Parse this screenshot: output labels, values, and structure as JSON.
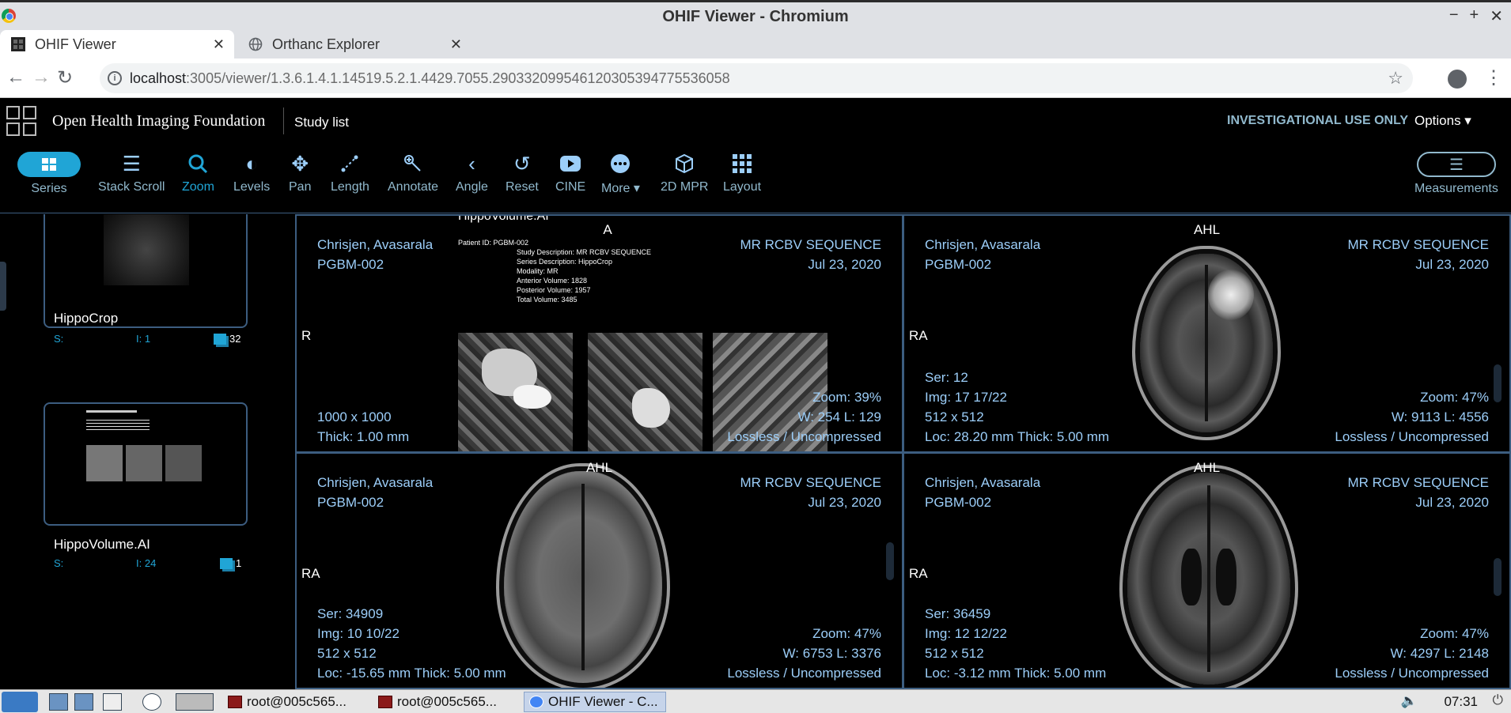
{
  "browser": {
    "window_title": "OHIF Viewer - Chromium",
    "window_buttons": [
      "−",
      "+",
      "✕"
    ],
    "tabs": [
      {
        "label": "OHIF Viewer",
        "close": "✕"
      },
      {
        "label": "Orthanc Explorer",
        "close": "✕"
      }
    ],
    "new_tab": "+",
    "url_host": "localhost",
    "url_path": ":3005/viewer/1.3.6.1.4.1.14519.5.2.1.4429.7055.290332099546120305394775536058",
    "info_glyph": "i",
    "star_glyph": "☆",
    "menu_glyph": "⋮"
  },
  "header": {
    "org_name": "Open Health Imaging Foundation",
    "study_list": "Study list",
    "investigational": "INVESTIGATIONAL USE ONLY",
    "options": "Options ▾"
  },
  "toolbar": {
    "series": "Series",
    "stack_scroll": "Stack Scroll",
    "zoom": "Zoom",
    "levels": "Levels",
    "pan": "Pan",
    "length": "Length",
    "annotate": "Annotate",
    "angle": "Angle",
    "reset": "Reset",
    "cine": "CINE",
    "more": "More ▾",
    "mpr": "2D MPR",
    "layout": "Layout",
    "measurements": "Measurements"
  },
  "series_panel": {
    "items": [
      {
        "title": "HippoCrop",
        "s_label": "S:",
        "i_label": "I: 1",
        "count": "32"
      },
      {
        "title": "HippoVolume.AI",
        "s_label": "S:",
        "i_label": "I: 24",
        "count": "1"
      }
    ]
  },
  "viewports": {
    "vp1": {
      "ori_top": "A",
      "ori_left": "R",
      "patient": "Chrisjen, Avasarala",
      "patient_id": "PGBM-002",
      "series_desc": "MR RCBV SEQUENCE",
      "date": "Jul 23, 2020",
      "dims": "1000 x 1000",
      "thick": "Thick: 1.00 mm",
      "zoom": "Zoom: 39%",
      "wl": "W: 254 L: 129",
      "compression": "Lossless / Uncompressed",
      "report_title": "HippoVolume.AI",
      "report_patient": "Patient ID: PGBM-002",
      "report_study": "Study Description: MR RCBV SEQUENCE",
      "report_series": "Series Description: HippoCrop",
      "report_modality": "Modality: MR",
      "report_anterior": "Anterior Volume: 1828",
      "report_posterior": "Posterior Volume: 1957",
      "report_total": "Total Volume: 3485"
    },
    "vp2": {
      "ori_top": "AHL",
      "ori_left": "RA",
      "patient": "Chrisjen, Avasarala",
      "patient_id": "PGBM-002",
      "series_desc": "MR RCBV SEQUENCE",
      "date": "Jul 23, 2020",
      "ser": "Ser: 12",
      "img": "Img: 17 17/22",
      "dims": "512 x 512",
      "loc": "Loc: 28.20 mm Thick: 5.00 mm",
      "zoom": "Zoom: 47%",
      "wl": "W: 9113 L: 4556",
      "compression": "Lossless / Uncompressed"
    },
    "vp3": {
      "ori_top": "AHL",
      "ori_left": "RA",
      "patient": "Chrisjen, Avasarala",
      "patient_id": "PGBM-002",
      "series_desc": "MR RCBV SEQUENCE",
      "date": "Jul 23, 2020",
      "ser": "Ser: 34909",
      "img": "Img: 10 10/22",
      "dims": "512 x 512",
      "loc": "Loc: -15.65 mm Thick: 5.00 mm",
      "zoom": "Zoom: 47%",
      "wl": "W: 6753 L: 3376",
      "compression": "Lossless / Uncompressed"
    },
    "vp4": {
      "ori_top": "AHL",
      "ori_left": "RA",
      "patient": "Chrisjen, Avasarala",
      "patient_id": "PGBM-002",
      "series_desc": "MR RCBV SEQUENCE",
      "date": "Jul 23, 2020",
      "ser": "Ser: 36459",
      "img": "Img: 12 12/22",
      "dims": "512 x 512",
      "loc": "Loc: -3.12 mm Thick: 5.00 mm",
      "zoom": "Zoom: 47%",
      "wl": "W: 4297 L: 2148",
      "compression": "Lossless / Uncompressed"
    }
  },
  "taskbar": {
    "tasks": [
      "root@005c565...",
      "root@005c565...",
      "OHIF Viewer - C..."
    ],
    "clock": "07:31",
    "volume": "🔈",
    "power": "⏻"
  },
  "colors": {
    "accent": "#20a5d6",
    "overlay_text": "#9ccef9",
    "border": "#3c5d80"
  }
}
